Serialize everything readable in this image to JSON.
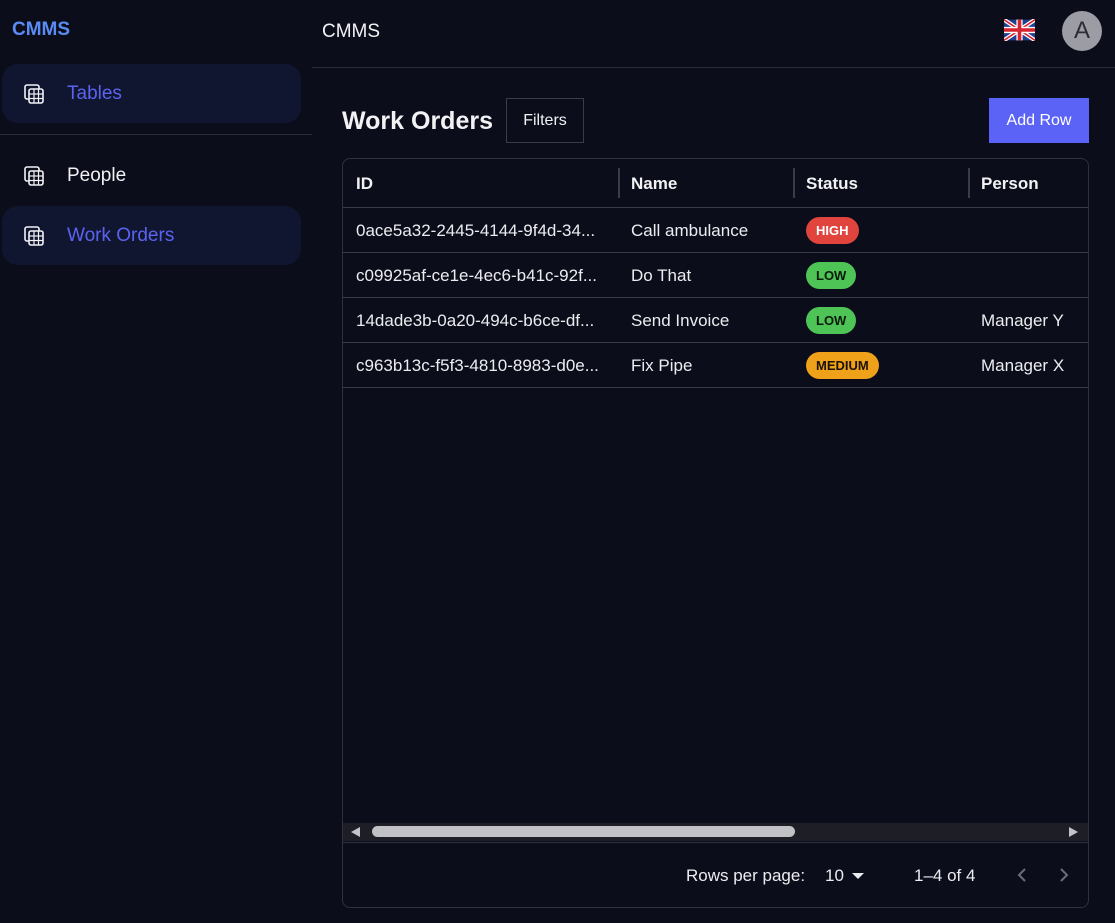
{
  "brand": "CMMS",
  "sidebar": {
    "items": [
      {
        "label": "Tables",
        "icon": "table-icon",
        "active": true
      },
      {
        "label": "People",
        "icon": "table-icon",
        "active": false
      },
      {
        "label": "Work Orders",
        "icon": "table-icon",
        "active": true
      }
    ]
  },
  "header": {
    "title": "CMMS",
    "language_icon": "uk-flag-icon",
    "avatar_initial": "A"
  },
  "page": {
    "title": "Work Orders",
    "filters_label": "Filters",
    "add_label": "Add Row"
  },
  "table": {
    "columns": [
      "ID",
      "Name",
      "Status",
      "Person"
    ],
    "rows": [
      {
        "id": "0ace5a32-2445-4144-9f4d-34...",
        "name": "Call ambulance",
        "status": "HIGH",
        "status_color": "#e0443c",
        "person": ""
      },
      {
        "id": "c09925af-ce1e-4ec6-b41c-92f...",
        "name": "Do That",
        "status": "LOW",
        "status_color": "#4dc455",
        "person": ""
      },
      {
        "id": "14dade3b-0a20-494c-b6ce-df...",
        "name": "Send Invoice",
        "status": "LOW",
        "status_color": "#4dc455",
        "person": "Manager Y"
      },
      {
        "id": "c963b13c-f5f3-4810-8983-d0e...",
        "name": "Fix Pipe",
        "status": "MEDIUM",
        "status_color": "#f0a11a",
        "person": "Manager X"
      }
    ]
  },
  "pagination": {
    "rows_per_page_label": "Rows per page:",
    "rows_per_page": "10",
    "range": "1–4 of 4"
  },
  "colors": {
    "accent": "#5a63f5",
    "background": "#0b0e1a"
  }
}
